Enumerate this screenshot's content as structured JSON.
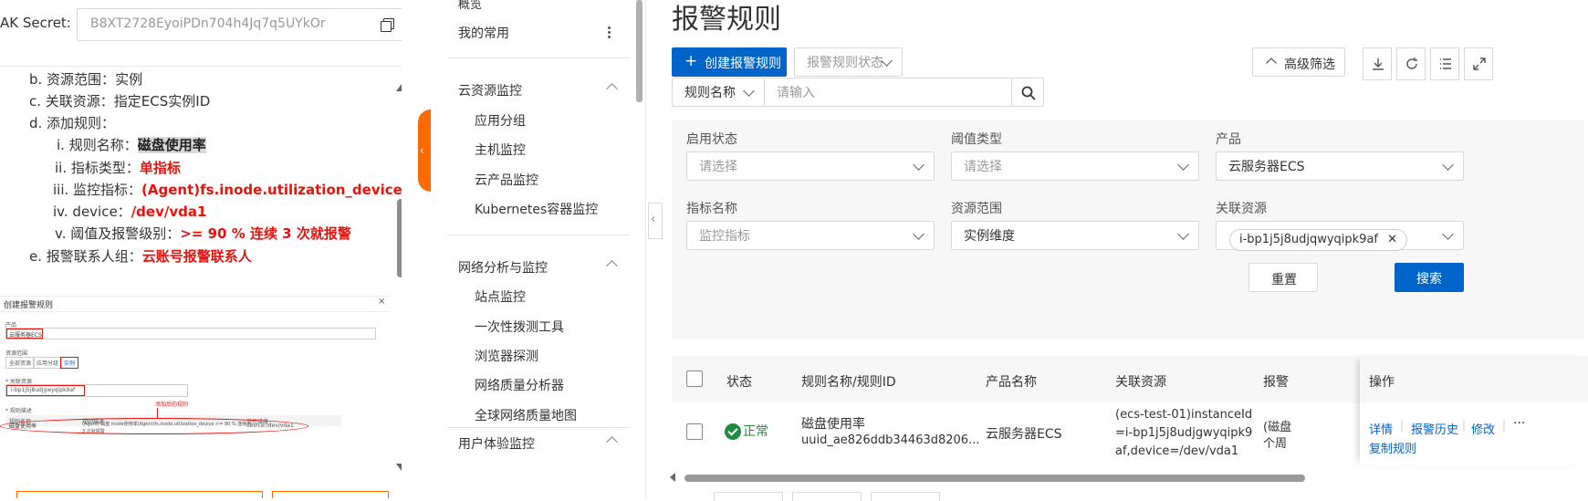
{
  "doc": {
    "ak_label": "AK Secret:",
    "ak_value": "B8XT2728EyoiPDn704h4Jq7q5UYkOr",
    "lines": [
      {
        "prefix": "b. 资源范围：",
        "value": "实例",
        "style": "plain"
      },
      {
        "prefix": "c. 关联资源：",
        "value": "指定ECS实例ID",
        "style": "plain"
      },
      {
        "prefix": "d. 添加规则：",
        "value": "",
        "style": "plain"
      },
      {
        "prefix": "i. 规则名称：",
        "value": "磁盘使用率",
        "style": "hl"
      },
      {
        "prefix": "ii. 指标类型：",
        "value": "单指标",
        "style": "red"
      },
      {
        "prefix": "iii. 监控指标：",
        "value": "(Agent)fs.inode.utilization_device",
        "style": "red"
      },
      {
        "prefix": "iv. device：",
        "value": "/dev/vda1",
        "style": "red"
      },
      {
        "prefix": "v. 阈值及报警级别：",
        "value": ">= 90 % 连续 3 次就报警",
        "style": "red"
      },
      {
        "prefix": "e. 报警联系人组：",
        "value": "云账号报警联系人",
        "style": "red"
      }
    ],
    "thumbnail": {
      "title": "创建报警规则",
      "close": "×",
      "product_label": "产品",
      "product_value": "云服务器ECS",
      "scope_label": "资源范围",
      "scope_tabs": [
        "全部资源",
        "应用分组",
        "实例"
      ],
      "resource_label": "* 关联资源",
      "resource_value": "i-bp1j5j8udjgwyqipk9af",
      "rule_label": "* 规则描述",
      "rule_headers": [
        "规则名称",
        "规则描述",
        "监控维度"
      ],
      "rule_note": "添加后的规则",
      "rule_row": [
        "磁盘使用率",
        "(Agent) 磁盘 inode使用率(Agent)fs.inode.utilization_device >= 90 % 连续",
        "device:/dev/vda1"
      ],
      "rule_row2": "3 次就报警"
    }
  },
  "nav": {
    "top_partial": "概览",
    "favorites": "我的常用",
    "groups": [
      {
        "title": "云资源监控",
        "items": [
          "应用分组",
          "主机监控",
          "云产品监控",
          "Kubernetes容器监控"
        ]
      },
      {
        "title": "网络分析与监控",
        "items": [
          "站点监控",
          "一次性拨测工具",
          "浏览器探测",
          "网络质量分析器",
          "全球网络质量地图"
        ]
      },
      {
        "title": "用户体验监控",
        "items": []
      }
    ]
  },
  "main": {
    "title": "报警规则",
    "create_button": "创建报警规则",
    "status_filter": "报警规则状态",
    "advanced_filter": "高级筛选",
    "search_field_select": "规则名称",
    "search_placeholder": "请输入",
    "filters": {
      "enable_status": {
        "label": "启用状态",
        "placeholder": "请选择"
      },
      "threshold_type": {
        "label": "阈值类型",
        "placeholder": "请选择"
      },
      "product": {
        "label": "产品",
        "value": "云服务器ECS"
      },
      "metric_name": {
        "label": "指标名称",
        "placeholder": "监控指标"
      },
      "resource_scope": {
        "label": "资源范围",
        "value": "实例维度"
      },
      "related_resource": {
        "label": "关联资源",
        "tag": "i-bp1j5j8udjqwyqipk9af"
      },
      "reset": "重置",
      "search": "搜索"
    },
    "table": {
      "headers": [
        "状态",
        "规则名称/规则ID",
        "产品名称",
        "关联资源",
        "报警",
        "操作"
      ],
      "sort_icon": "↓↑",
      "row": {
        "status": "正常",
        "rule_name": "磁盘使用率",
        "rule_id": "uuid_ae826ddb34463d8206...",
        "product": "云服务器ECS",
        "resource_lines": [
          "(ecs-test-01)instanceId",
          "=i-bp1j5j8udjgwyqipk9",
          "af,device=/dev/vda1"
        ],
        "alarm_partial_1": "(磁盘",
        "alarm_partial_2": "个周",
        "ops": [
          "详情",
          "报警历史",
          "修改",
          "复制规则"
        ],
        "more": "···",
        "sep": "|"
      }
    }
  }
}
